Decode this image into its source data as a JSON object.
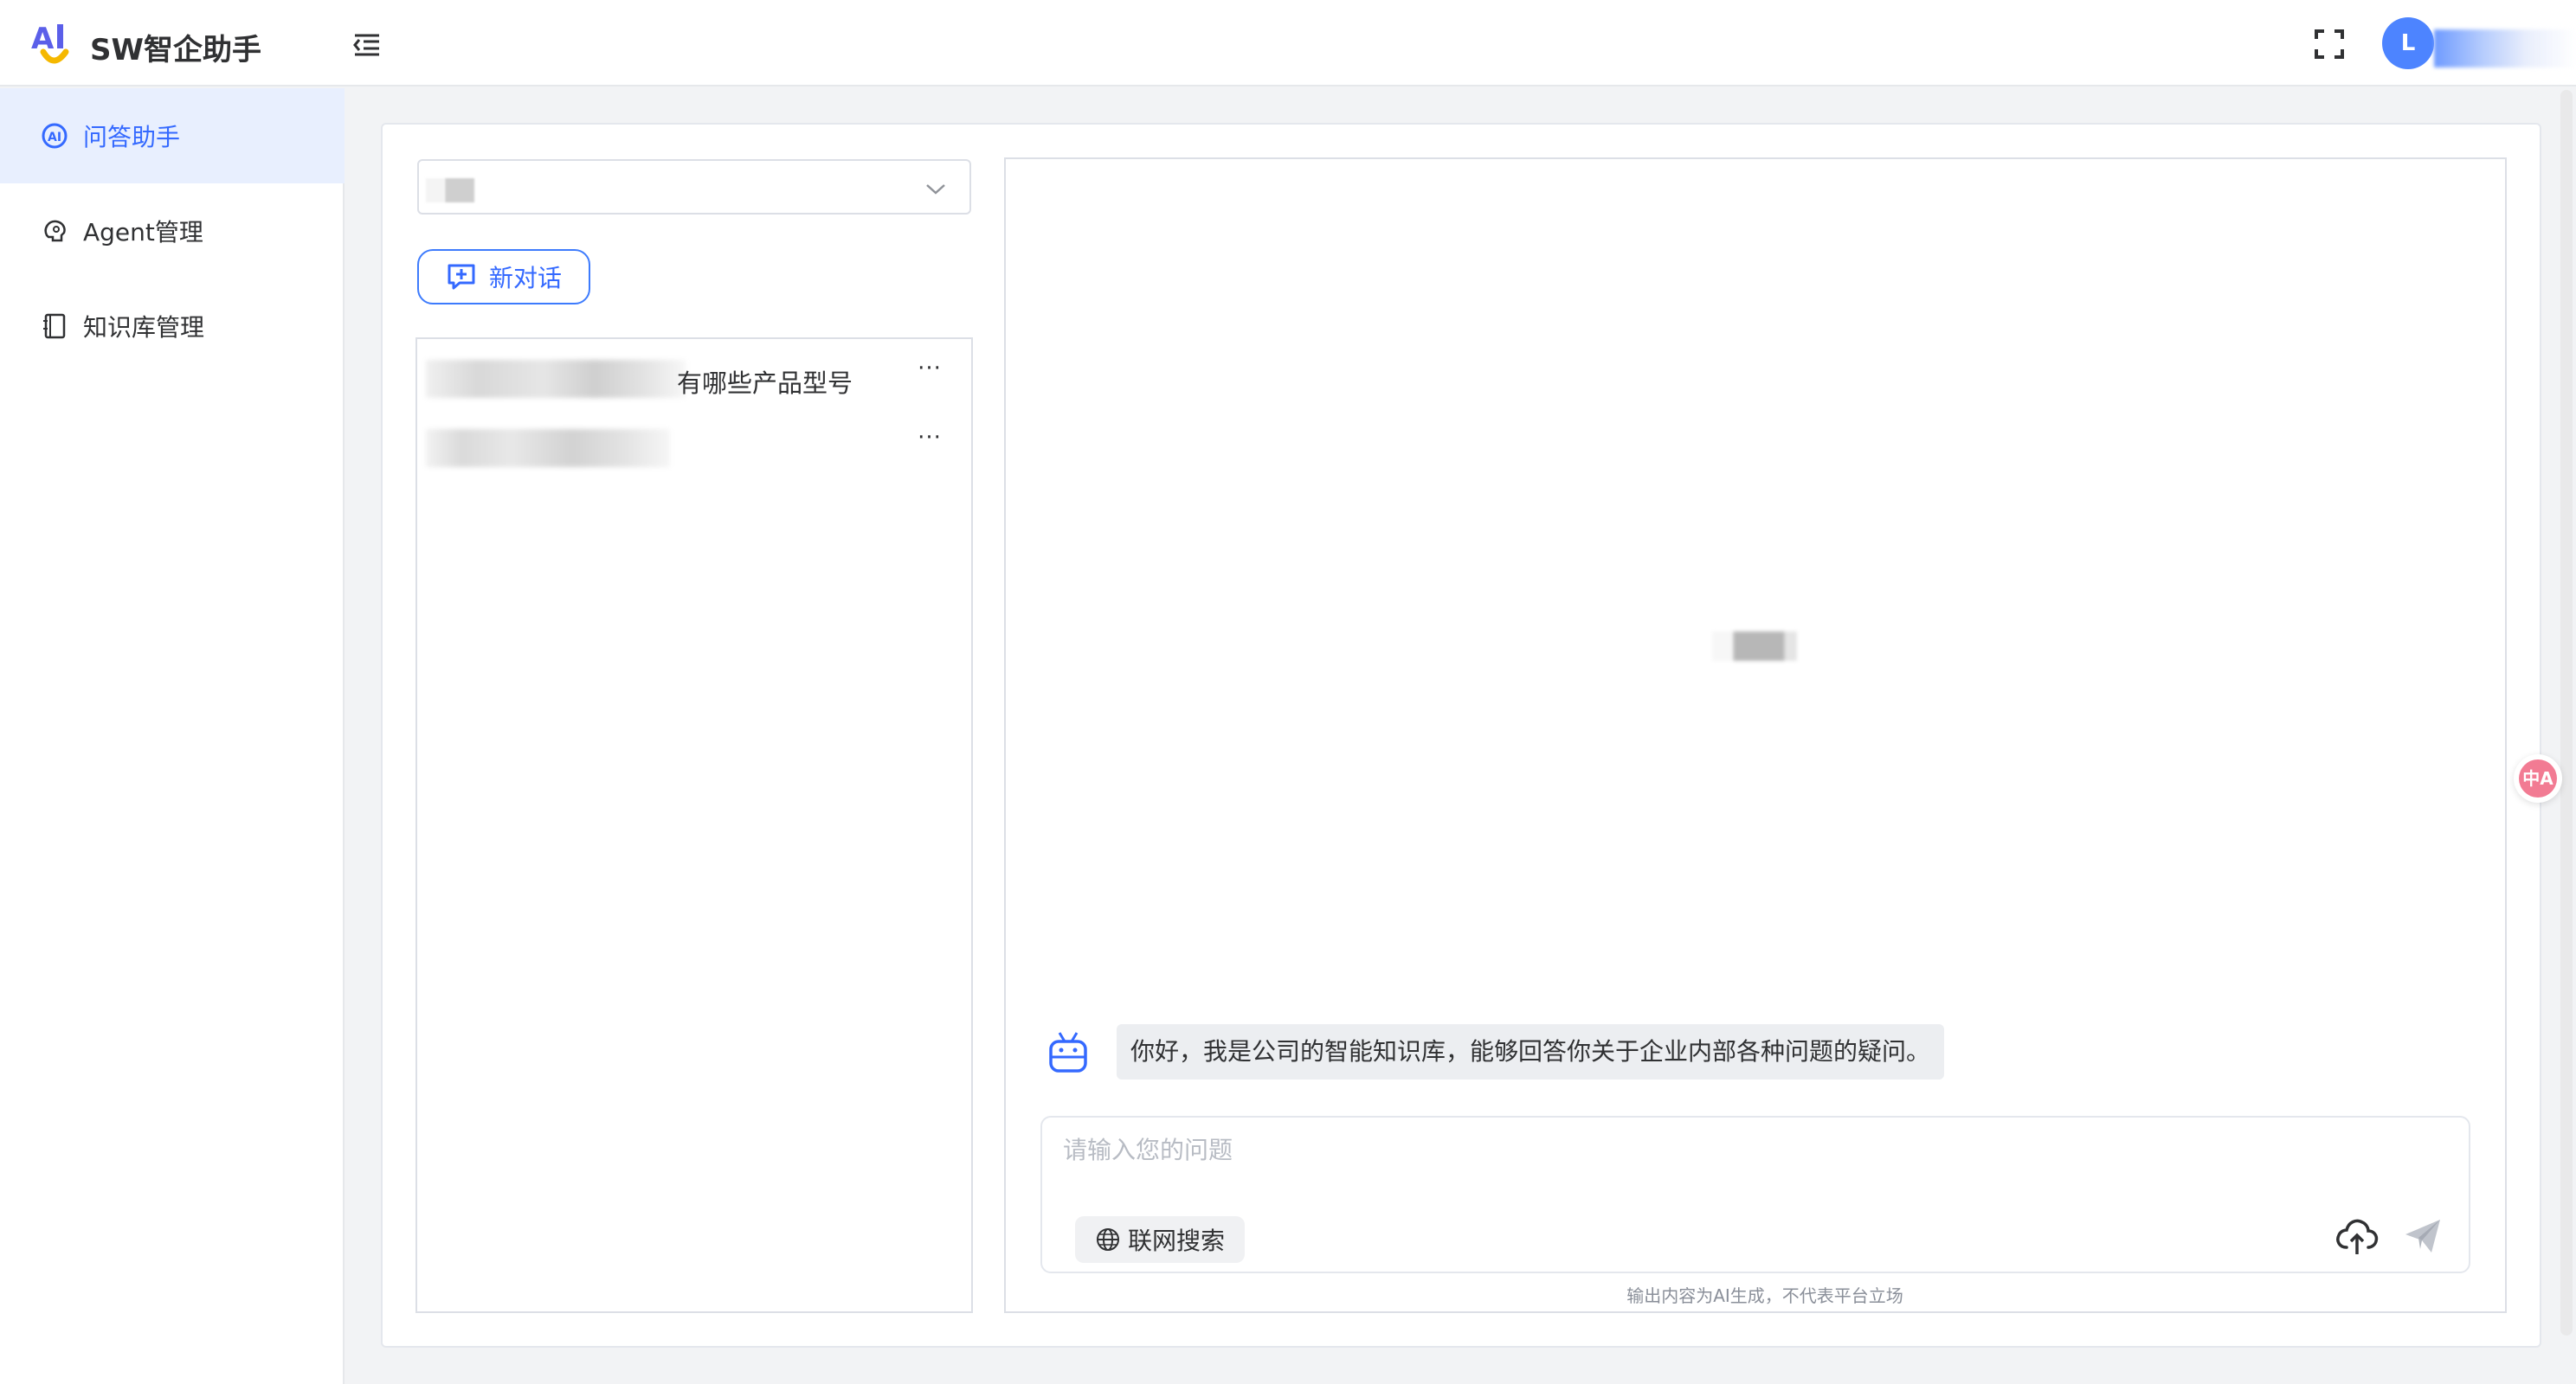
{
  "header": {
    "app_title": "SW智企助手",
    "logo_text": "AI",
    "avatar_letter": "L",
    "icons": [
      "menu-collapse-icon",
      "fullscreen-icon"
    ]
  },
  "sidebar": {
    "items": [
      {
        "label": "问答助手",
        "icon": "ai-chat-icon",
        "active": true
      },
      {
        "label": "Agent管理",
        "icon": "agent-icon",
        "active": false
      },
      {
        "label": "知识库管理",
        "icon": "knowledge-base-icon",
        "active": false
      }
    ]
  },
  "left_panel": {
    "new_chat_label": "新对话",
    "conversations": [
      {
        "title_visible": "有哪些产品型号",
        "more": "···"
      },
      {
        "title_visible": "",
        "more": "···"
      }
    ]
  },
  "chat": {
    "greeting": "你好，我是公司的智能知识库，能够回答你关于企业内部各种问题的疑问。",
    "input_placeholder": "请输入您的问题",
    "web_search_label": "联网搜索",
    "disclaimer": "输出内容为AI生成，不代表平台立场"
  },
  "floating": {
    "translate_label": "中A"
  },
  "colors": {
    "accent": "#3469ff",
    "active_bg": "#e8effe",
    "avatar_bg": "#4d84ff",
    "translate_bg": "#f27b93"
  }
}
